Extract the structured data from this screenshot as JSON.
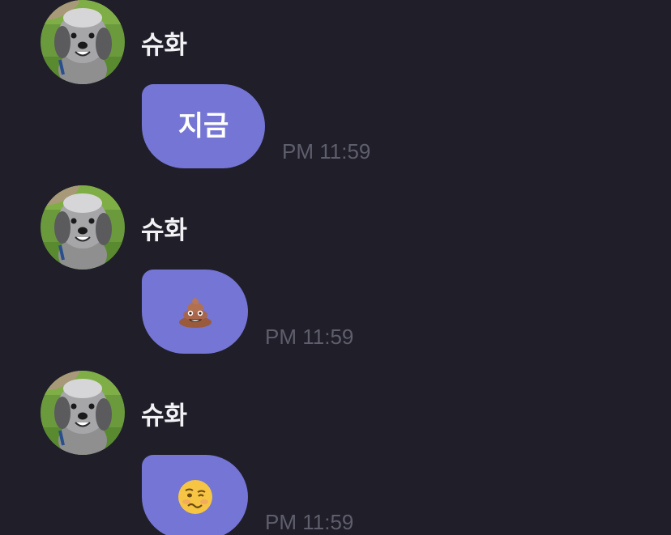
{
  "messages": [
    {
      "sender": "슈화",
      "text": "지금",
      "time": "PM 11:59",
      "emoji": null
    },
    {
      "sender": "슈화",
      "text": "",
      "time": "PM 11:59",
      "emoji": "pile-of-poo"
    },
    {
      "sender": "슈화",
      "text": "",
      "time": "PM 11:59",
      "emoji": "woozy-face"
    }
  ],
  "colors": {
    "background": "#1f1e29",
    "bubble": "#7475d4",
    "sender_text": "#f2f2f5",
    "timestamp": "#5e5e6c"
  }
}
